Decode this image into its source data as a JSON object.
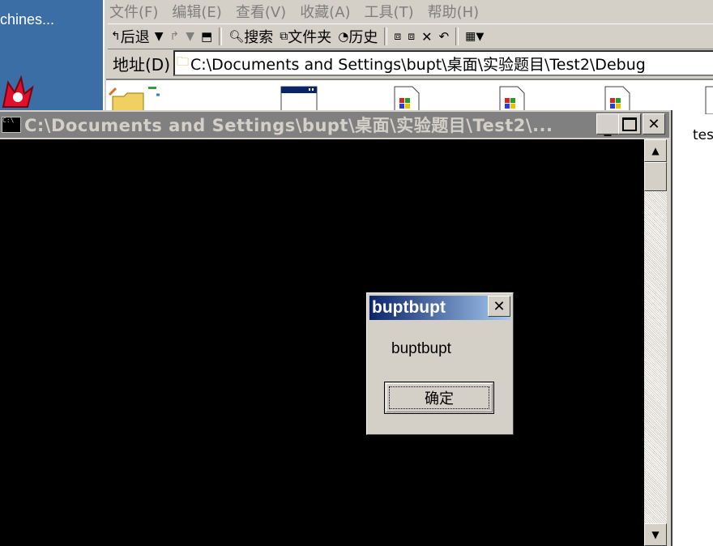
{
  "desktop": {
    "label": "chines..."
  },
  "explorer": {
    "menu": [
      "文件(F)",
      "编辑(E)",
      "查看(V)",
      "收藏(A)",
      "工具(T)",
      "帮助(H)"
    ],
    "toolbar": {
      "back": "后退",
      "search": "搜索",
      "folders": "文件夹",
      "history": "历史"
    },
    "address": {
      "label": "地址(D)",
      "value": "C:\\Documents and Settings\\bupt\\桌面\\实验题目\\Test2\\Debug"
    },
    "files": {
      "partial_label": "tes"
    }
  },
  "console": {
    "title": "C:\\Documents and Settings\\bupt\\桌面\\实验题目\\Test2\\...",
    "icon_text": "C:\\"
  },
  "msgbox": {
    "title": "buptbupt",
    "message": "buptbupt",
    "ok_label": "确定"
  }
}
